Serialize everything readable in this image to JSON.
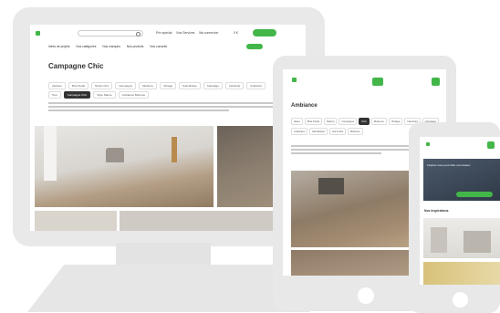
{
  "desktop": {
    "logo": "",
    "search_placeholder": "",
    "utility_links": [
      "Prix spécial",
      "Nos Services",
      "Ma connexion"
    ],
    "cart": "0 €",
    "cta_label": "",
    "nav_items": [
      "Idées de projets",
      "Nos catégories",
      "Nos marques",
      "Nos produits",
      "Nos conseils"
    ],
    "nav_button": "",
    "breadcrumb": "",
    "page_title": "Campagne Chic",
    "filter_row1": [
      "Intérieur",
      "Bois Flotté",
      "Rustic Chic",
      "Campagne",
      "Moderne",
      "Vintage",
      "Scandinave",
      "Carrelage",
      "Industriel",
      "Collection"
    ],
    "filter_row2": [
      "Tout",
      "Campagne Chic",
      "Style Nature",
      "Ambiance Bohème"
    ],
    "filter_row2_active_index": 1
  },
  "tablet": {
    "logo": "",
    "breadcrumb": "",
    "page_title": "Ambiance",
    "filters": [
      "Idées",
      "Bois Flotté",
      "Nature",
      "Campagne",
      "Chic",
      "Moderne",
      "Vintage",
      "Industriel",
      "Carrelage",
      "Collection",
      "Ma Maison",
      "Sol & Mur",
      "Bohème"
    ],
    "filter_active_index": 4
  },
  "phone": {
    "logo": "",
    "hero_text": "Inspirez-vous pour faire vos travaux",
    "hero_button": "",
    "section_title": "Nos Inspirations"
  }
}
